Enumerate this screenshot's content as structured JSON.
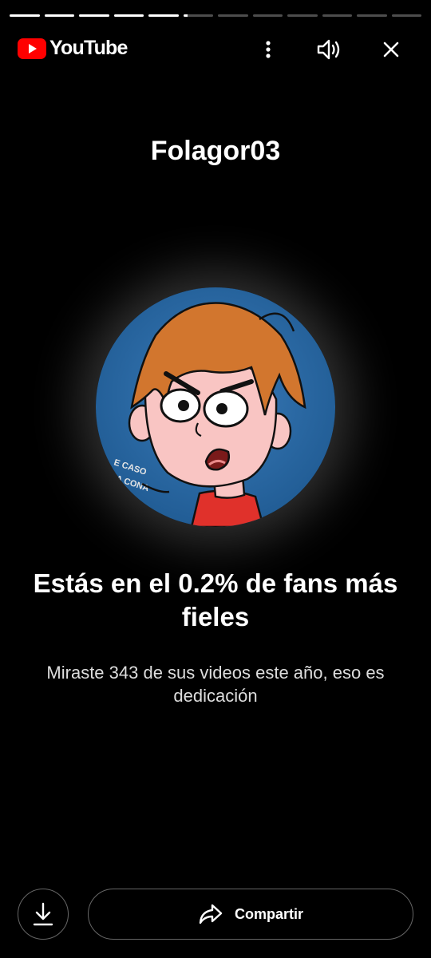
{
  "progress": {
    "total_segments": 12,
    "completed_segments": 5,
    "current_segment_fraction": 0.15
  },
  "header": {
    "brand": "YouTube",
    "icons": {
      "logo": "youtube-logo",
      "more": "more-vertical-icon",
      "sound": "volume-icon",
      "close": "close-icon"
    }
  },
  "channel": {
    "name": "Folagor03"
  },
  "avatar": {
    "watermark_line1": "E CASO",
    "watermark_line2": "LA CONA"
  },
  "stat": {
    "headline": "Estás en el 0.2% de fans más fieles",
    "detail": "Miraste 343 de sus videos este año, eso es dedicación"
  },
  "actions": {
    "share_label": "Compartir",
    "icons": {
      "download": "download-icon",
      "share": "share-icon"
    }
  },
  "colors": {
    "background": "#000000",
    "brand_red": "#ff0000",
    "avatar_bg": "#2f6ea8",
    "hair": "#d2762e",
    "shirt": "#e0312b"
  }
}
